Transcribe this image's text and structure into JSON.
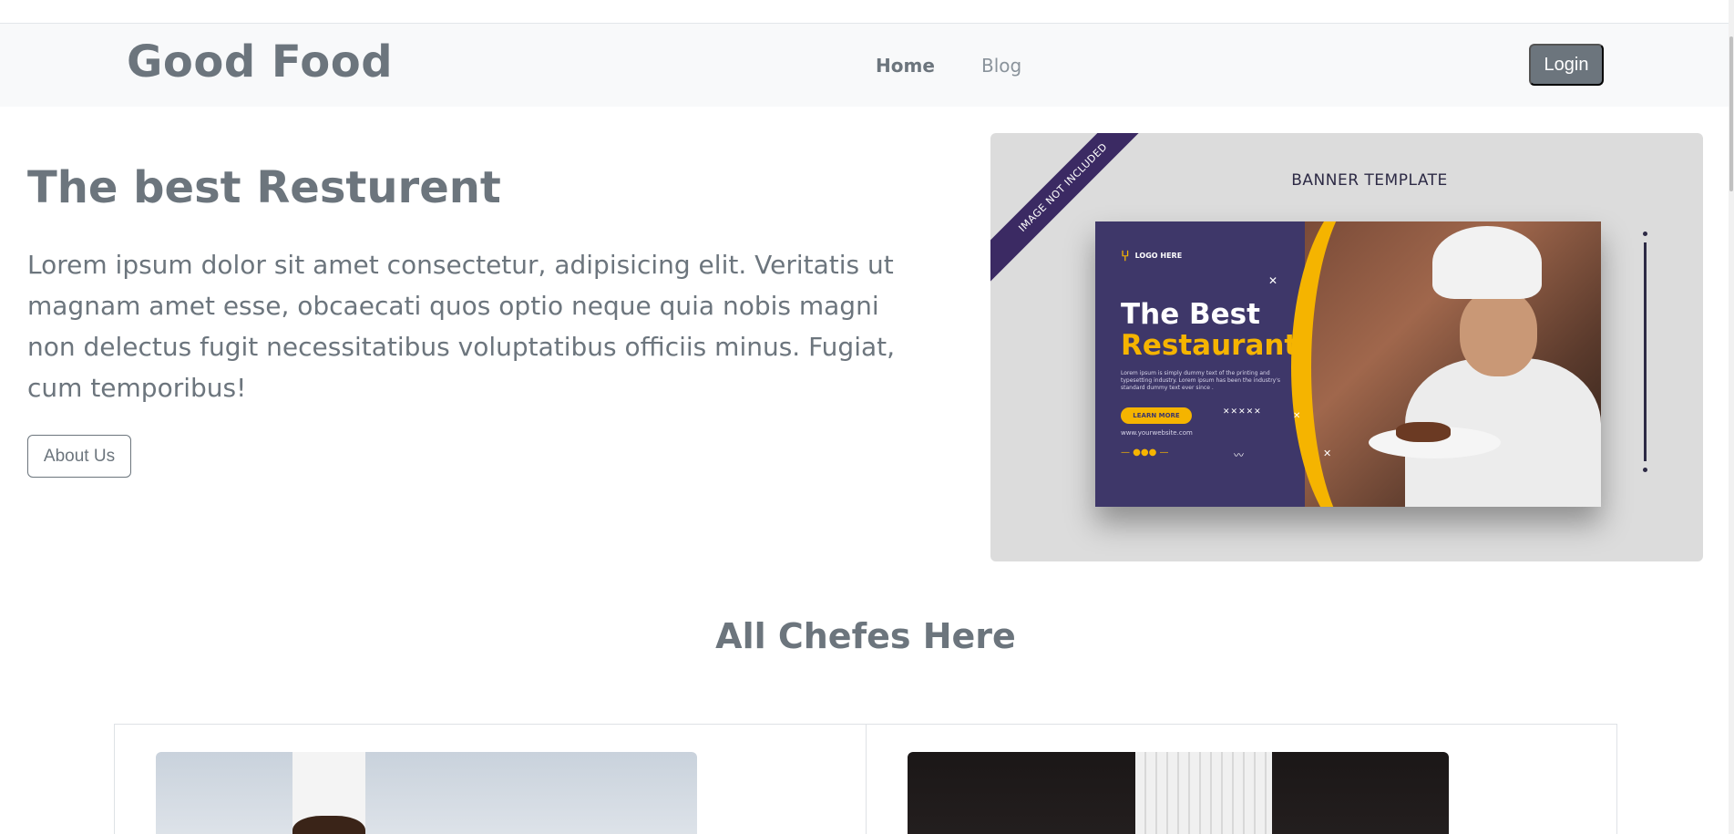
{
  "navbar": {
    "brand": "Good Food",
    "links": [
      {
        "label": "Home",
        "active": true
      },
      {
        "label": "Blog",
        "active": false
      }
    ],
    "login_label": "Login"
  },
  "hero": {
    "title": "The best Resturent",
    "text": "Lorem ipsum dolor sit amet consectetur, adipisicing elit. Veritatis ut magnam amet esse, obcaecati quos optio neque quia nobis magni non delectus fugit necessitatibus voluptatibus officiis minus. Fugiat, cum temporibus!",
    "button_label": "About Us"
  },
  "banner": {
    "ribbon": "IMAGE NOT INCLUDED",
    "label": "BANNER TEMPLATE",
    "card": {
      "logo": "LOGO HERE",
      "title_line1": "The Best",
      "title_line2": "Restaurant",
      "body": "Lorem ipsum is simply dummy text of the printing and typesetting industry. Lorem ipsum has been the industry's standard dummy text ever since .",
      "button": "LEARN MORE",
      "url": "www.yourwebsite.com"
    },
    "colors": {
      "card_bg": "#3e3769",
      "accent": "#f5b400"
    }
  },
  "chefs": {
    "title": "All Chefes Here"
  },
  "colors": {
    "text": "#6c757d",
    "navbar_bg": "#f8f9fa",
    "button_bg": "#6c757d"
  }
}
